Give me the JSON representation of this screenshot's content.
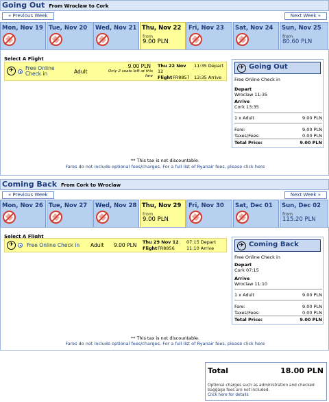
{
  "outbound": {
    "title": "Going Out",
    "route": "From Wroclaw to Cork",
    "prev": "« Previous Week",
    "next": "Next Week »",
    "days": [
      {
        "label": "Mon, Nov 19",
        "available": false
      },
      {
        "label": "Tue, Nov 20",
        "available": false
      },
      {
        "label": "Wed, Nov 21",
        "available": false
      },
      {
        "label": "Thu, Nov 22",
        "available": true,
        "from": "from",
        "price": "9.00 PLN",
        "selected": true
      },
      {
        "label": "Fri, Nov 23",
        "available": false
      },
      {
        "label": "Sat, Nov 24",
        "available": false
      },
      {
        "label": "Sun, Nov 25",
        "available": true,
        "from": "from",
        "price": "80.60 PLN"
      }
    ],
    "select_title": "Select A Flight",
    "fare_name": "Free Online Check in",
    "passenger": "Adult",
    "price": "9.00 PLN",
    "seats_note": "Only 2 seats left at this fare",
    "date_line1": "Thu 22 Nov",
    "date_line2": "12",
    "flight_label": "Flight",
    "flight_no": "FR8857",
    "depart_time": "11:35 Depart",
    "arrive_time": "13:35 Arrive",
    "summary": {
      "title": "Going Out",
      "fare": "Free Online Check in",
      "depart_label": "Depart",
      "depart_value": "Wroclaw 11:35",
      "arrive_label": "Arrive",
      "arrive_value": "Cork 13:35",
      "pax_label": "1 x Adult",
      "pax_value": "9.00 PLN",
      "fare_label": "Fare:",
      "fare_value": "9.00 PLN",
      "tax_label": "Taxes/Fees:",
      "tax_value": "0.00 PLN",
      "total_label": "Total Price:",
      "total_value": "9.00 PLN"
    },
    "tax_note": "** This tax is not discountable.",
    "fees_note": "Fares do not include optional fees/charges. For a full list of Ryanair fees, please click here"
  },
  "inbound": {
    "title": "Coming Back",
    "route": "From Cork to Wroclaw",
    "prev": "« Previous Week",
    "next": "Next Week »",
    "days": [
      {
        "label": "Mon, Nov 26",
        "available": false
      },
      {
        "label": "Tue, Nov 27",
        "available": false
      },
      {
        "label": "Wed, Nov 28",
        "available": false
      },
      {
        "label": "Thu, Nov 29",
        "available": true,
        "from": "from",
        "price": "9.00 PLN",
        "selected": true
      },
      {
        "label": "Fri, Nov 30",
        "available": false
      },
      {
        "label": "Sat, Dec 01",
        "available": false
      },
      {
        "label": "Sun, Dec 02",
        "available": true,
        "from": "from",
        "price": "115.20 PLN"
      }
    ],
    "select_title": "Select A Flight",
    "fare_name": "Free Online Check in",
    "passenger": "Adult",
    "price": "9.00 PLN",
    "date_line1": "Thu 29 Nov 12",
    "flight_label": "Flight",
    "flight_no": "FR8856",
    "depart_time": "07:15 Depart",
    "arrive_time": "11:10 Arrive",
    "summary": {
      "title": "Coming Back",
      "fare": "Free Online Check in",
      "depart_label": "Depart",
      "depart_value": "Cork 07:15",
      "arrive_label": "Arrive",
      "arrive_value": "Wroclaw 11:10",
      "pax_label": "1 x Adult",
      "pax_value": "9.00 PLN",
      "fare_label": "Fare:",
      "fare_value": "9.00 PLN",
      "tax_label": "Taxes/Fees:",
      "tax_value": "0.00 PLN",
      "total_label": "Total Price:",
      "total_value": "9.00 PLN"
    },
    "tax_note": "** This tax is not discountable.",
    "fees_note": "Fares do not include optional fees/charges. For a full list of Ryanair fees, please click here"
  },
  "total": {
    "label": "Total",
    "value": "18.00 PLN",
    "note": "Optional charges such as administration and checked baggage fees are not included.",
    "link": "Click here for details"
  },
  "colors": {
    "accent": "#1d3c7c",
    "tab": "#b8d0f0",
    "selected": "#ffff99",
    "unavailable": "#d23b2d"
  }
}
